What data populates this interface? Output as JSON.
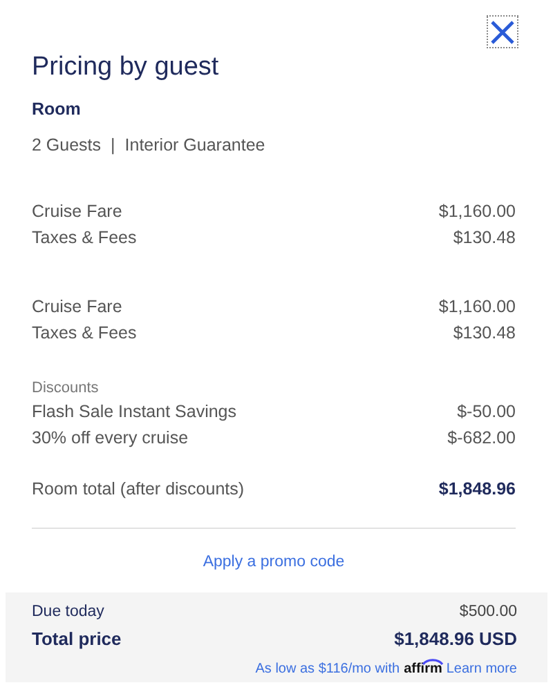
{
  "title": "Pricing by guest",
  "room": {
    "heading": "Room",
    "guests": "2 Guests",
    "separator": "|",
    "category": "Interior Guarantee"
  },
  "guest_groups": [
    {
      "lines": [
        {
          "label": "Cruise Fare",
          "amount": "$1,160.00"
        },
        {
          "label": "Taxes & Fees",
          "amount": "$130.48"
        }
      ]
    },
    {
      "lines": [
        {
          "label": "Cruise Fare",
          "amount": "$1,160.00"
        },
        {
          "label": "Taxes & Fees",
          "amount": "$130.48"
        }
      ]
    }
  ],
  "discounts": {
    "heading": "Discounts",
    "lines": [
      {
        "label": "Flash Sale Instant Savings",
        "amount": "$-50.00"
      },
      {
        "label": "30% off every cruise",
        "amount": "$-682.00"
      }
    ]
  },
  "room_total": {
    "label": "Room total (after discounts)",
    "amount": "$1,848.96"
  },
  "promo_link": "Apply a promo code",
  "footer": {
    "due_today": {
      "label": "Due today",
      "amount": "$500.00"
    },
    "total": {
      "label": "Total price",
      "amount": "$1,848.96 USD"
    },
    "financing": {
      "text": "As low as $116/mo with",
      "brand": "affirm",
      "link": "Learn more"
    }
  }
}
